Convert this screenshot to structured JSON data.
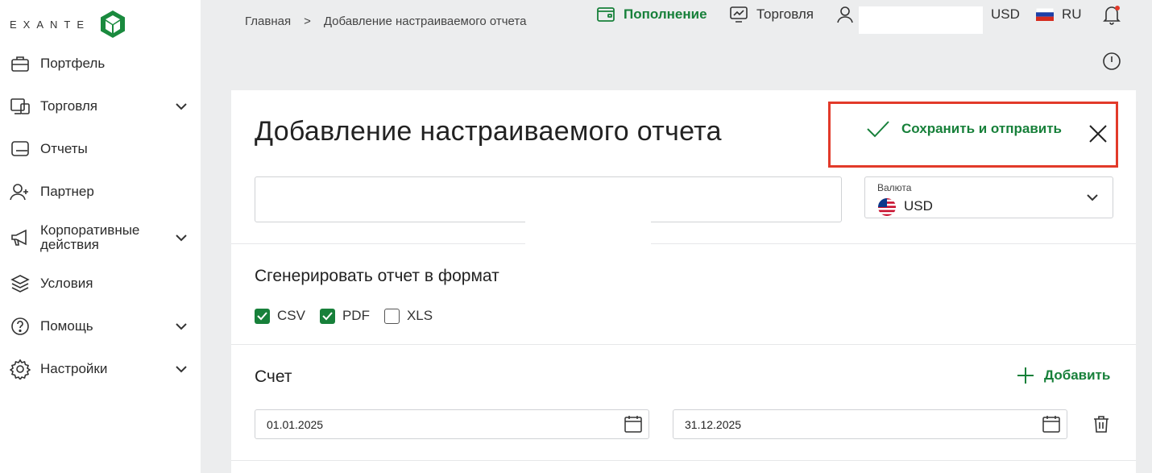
{
  "brand": {
    "logo_text": "EXANTE"
  },
  "sidebar": {
    "items": [
      {
        "label": "Портфель",
        "icon": "briefcase-icon",
        "expandable": false
      },
      {
        "label": "Торговля",
        "icon": "monitor-icon",
        "expandable": true
      },
      {
        "label": "Отчеты",
        "icon": "report-icon",
        "expandable": false
      },
      {
        "label": "Партнер",
        "icon": "user-plus-icon",
        "expandable": false
      },
      {
        "label": "Корпоративные",
        "label2": "действия",
        "icon": "megaphone-icon",
        "expandable": true
      },
      {
        "label": "Условия",
        "icon": "layers-icon",
        "expandable": false
      },
      {
        "label": "Помощь",
        "icon": "help-icon",
        "expandable": true
      },
      {
        "label": "Настройки",
        "icon": "gear-icon",
        "expandable": true
      }
    ]
  },
  "breadcrumb": {
    "home": "Главная",
    "separator": ">",
    "current": "Добавление настраиваемого отчета"
  },
  "topbar": {
    "deposit": "Пополнение",
    "trading": "Торговля",
    "currency": "USD",
    "language": "RU"
  },
  "form": {
    "title": "Добавление настраиваемого отчета",
    "save_label": "Сохранить и отправить",
    "name_value": "",
    "currency_label": "Валюта",
    "currency_value": "USD",
    "format_title": "Сгенерировать отчет в формат",
    "formats": [
      {
        "label": "CSV",
        "checked": true
      },
      {
        "label": "PDF",
        "checked": true
      },
      {
        "label": "XLS",
        "checked": false
      }
    ],
    "account_title": "Счет",
    "add_label": "Добавить",
    "date_from": "01.01.2025",
    "date_to": "31.12.2025"
  },
  "colors": {
    "accent": "#17803a",
    "highlight": "#e23a2a",
    "background": "#ecedee"
  }
}
